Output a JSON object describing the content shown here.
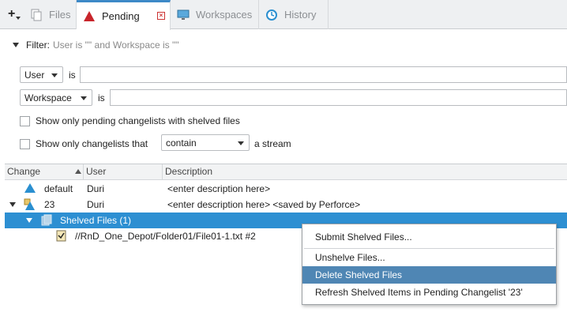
{
  "tabs": {
    "files": "Files",
    "pending": "Pending",
    "workspaces": "Workspaces",
    "history": "History"
  },
  "filter": {
    "label": "Filter:",
    "description": "User is \"\" and Workspace is \"\"",
    "user_combo": "User",
    "user_is": "is",
    "user_value": "",
    "workspace_combo": "Workspace",
    "workspace_is": "is",
    "workspace_value": "",
    "shelved_checkbox_label": "Show only pending changelists with shelved files",
    "stream_checkbox_label": "Show only changelists that",
    "stream_mode": "contain",
    "stream_suffix": "a stream"
  },
  "table": {
    "columns": [
      "Change",
      "User",
      "Description"
    ],
    "rows": [
      {
        "change": "default",
        "user": "Duri",
        "description": "<enter description here>"
      },
      {
        "change": "23",
        "user": "Duri",
        "description": "<enter description here> <saved by Perforce>"
      },
      {
        "change": "Shelved Files (1)",
        "user": "",
        "description": ""
      },
      {
        "change": "//RnD_One_Depot/Folder01/File01-1.txt #2",
        "user": "",
        "description": ""
      }
    ]
  },
  "context_menu": {
    "items": [
      "Submit Shelved Files...",
      "Unshelve Files...",
      "Delete Shelved Files",
      "Refresh Shelved Items in Pending Changelist '23'"
    ]
  },
  "colors": {
    "accent": "#3d89c7",
    "selection": "#2d8fd2",
    "menu_highlight": "#4f86b4"
  }
}
